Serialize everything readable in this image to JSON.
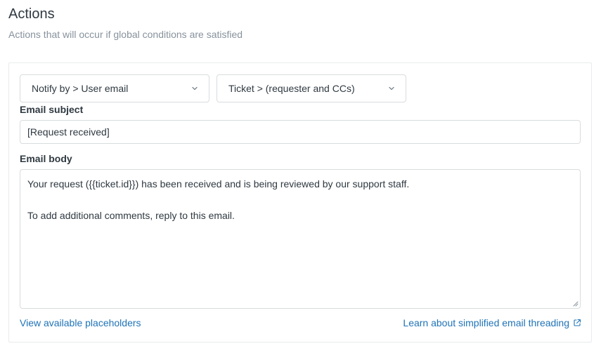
{
  "section": {
    "title": "Actions",
    "subtitle": "Actions that will occur if global conditions are satisfied"
  },
  "action": {
    "type_select": "Notify by > User email",
    "target_select": "Ticket > (requester and CCs)"
  },
  "email_subject": {
    "label": "Email subject",
    "value": "[Request received]"
  },
  "email_body": {
    "label": "Email body",
    "line1": "Your request ({{ticket.id}}) has been received and is being reviewed by our support staff.",
    "line2": "",
    "line3": "To add additional comments, reply to this email."
  },
  "links": {
    "placeholders": "View available placeholders",
    "threading": "Learn about simplified email threading"
  },
  "colors": {
    "link": "#1f73b7",
    "border": "#d8dcde",
    "muted_text": "#87929d"
  },
  "icons": [
    "chevron-down-icon",
    "external-link-icon",
    "resize-grip-icon"
  ]
}
